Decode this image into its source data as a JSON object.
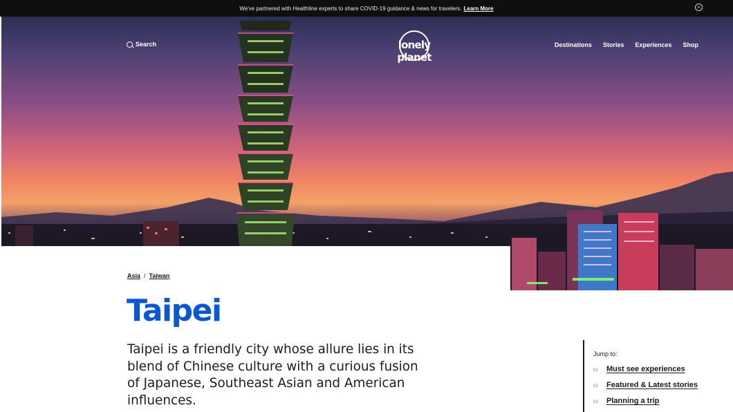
{
  "announcement": {
    "text": "We've partnered with Healthline experts to share COVID-19 guidance & news for travelers.",
    "link_label": "Learn More",
    "close_glyph": "×"
  },
  "nav": {
    "search_label": "Search",
    "logo_text": "lonely planet",
    "menu": [
      "Destinations",
      "Stories",
      "Experiences",
      "Shop"
    ]
  },
  "breadcrumb": {
    "items": [
      "Asia",
      "Taiwan"
    ],
    "separator": "/"
  },
  "page_title": "Taipei",
  "intro": "Taipei is a friendly city whose allure lies in its blend of Chinese culture with a curious fusion of Japanese, Southeast Asian and American influences.",
  "jump_to": {
    "label": "Jump to:",
    "items": [
      {
        "num": "01",
        "label": "Must see experiences"
      },
      {
        "num": "02",
        "label": "Featured & Latest stories"
      },
      {
        "num": "03",
        "label": "Planning a trip"
      }
    ]
  },
  "colors": {
    "title_blue": "#0957d6",
    "topbar_bg": "#0f0f0f",
    "text_dark": "#1c1c1c"
  }
}
